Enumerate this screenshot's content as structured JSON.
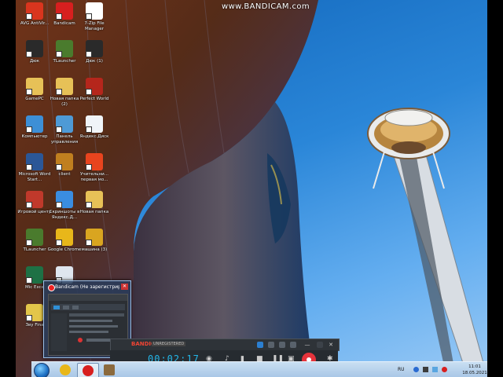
{
  "watermark": "www.BANDICAM.com",
  "desktop_icons": [
    {
      "label": "AVG AntiVir...",
      "icon": "avg-icon",
      "color": "#d9351e",
      "col": 0,
      "row": 0
    },
    {
      "label": "Bandicam",
      "icon": "bandicam-icon",
      "color": "#d71f1f",
      "col": 1,
      "row": 0
    },
    {
      "label": "7-Zip File Manager",
      "icon": "7zip-icon",
      "color": "#ffffff",
      "col": 2,
      "row": 0
    },
    {
      "label": "Дюк",
      "icon": "duck-app-icon",
      "color": "#2a2a2a",
      "col": 0,
      "row": 1
    },
    {
      "label": "TLauncher",
      "icon": "tlauncher-icon",
      "color": "#4a7b2d",
      "col": 1,
      "row": 1
    },
    {
      "label": "Дюк (1)",
      "icon": "duck-app-icon",
      "color": "#2a2a2a",
      "col": 2,
      "row": 1
    },
    {
      "label": "GamePC",
      "icon": "folder-icon",
      "color": "#e7c157",
      "col": 0,
      "row": 2
    },
    {
      "label": "Новая папка (2)",
      "icon": "folder-icon",
      "color": "#e7c157",
      "col": 1,
      "row": 2
    },
    {
      "label": "Perfect World",
      "icon": "perfect-world-icon",
      "color": "#b5261c",
      "col": 2,
      "row": 2
    },
    {
      "label": "Компьютер",
      "icon": "computer-icon",
      "color": "#3d8fd6",
      "col": 0,
      "row": 3
    },
    {
      "label": "Панель управления",
      "icon": "control-panel-icon",
      "color": "#4e9ad6",
      "col": 1,
      "row": 3
    },
    {
      "label": "Яндекс.Диск",
      "icon": "yandex-disk-icon",
      "color": "#f0f4f8",
      "col": 2,
      "row": 3
    },
    {
      "label": "Microsoft Word Start...",
      "icon": "word-icon",
      "color": "#2b5797",
      "col": 0,
      "row": 4
    },
    {
      "label": "client",
      "icon": "client-icon",
      "color": "#c07f1f",
      "col": 1,
      "row": 4
    },
    {
      "label": "Учительни... первая мо...",
      "icon": "media-icon",
      "color": "#e8441e",
      "col": 2,
      "row": 4
    },
    {
      "label": "Игровой центр",
      "icon": "game-center-icon",
      "color": "#c0392b",
      "col": 0,
      "row": 5
    },
    {
      "label": "Скриншоты в Яндекс.Д...",
      "icon": "screenshots-icon",
      "color": "#3a8de0",
      "col": 1,
      "row": 5
    },
    {
      "label": "Новая папка",
      "icon": "folder-icon",
      "color": "#e7c157",
      "col": 2,
      "row": 5
    },
    {
      "label": "TLauncher",
      "icon": "tlauncher-icon",
      "color": "#4a7b2d",
      "col": 0,
      "row": 6
    },
    {
      "label": "Google Chrome",
      "icon": "chrome-icon",
      "color": "#e8b71a",
      "col": 1,
      "row": 6
    },
    {
      "label": "машина (3)",
      "icon": "file-icon",
      "color": "#d9a520",
      "col": 2,
      "row": 6
    },
    {
      "label": "Mic Exce",
      "icon": "excel-icon",
      "color": "#1e7145",
      "col": 0,
      "row": 7
    },
    {
      "label": "",
      "icon": "paw-icon",
      "color": "#dfe6ee",
      "col": 1,
      "row": 7
    },
    {
      "label": "Зву Fina",
      "icon": "sound-icon",
      "color": "#e3c64a",
      "col": 0,
      "row": 8
    }
  ],
  "bandicam_bar": {
    "brand": "BANDICAM",
    "registered": "UNREGISTERED",
    "timer": "00:02:17",
    "minimize": "—",
    "close": "✕"
  },
  "thumbnail": {
    "title": "Bandicam (Не зарегистрир...",
    "close": "✕"
  },
  "tray": {
    "lang": "RU",
    "time": "11:01",
    "date": "18.05.2021"
  },
  "taskbar_buttons": [
    {
      "icon": "chrome-icon",
      "color": "#e8b71a"
    },
    {
      "icon": "bandicam-icon",
      "color": "#d71f1f"
    },
    {
      "icon": "minecraft-icon",
      "color": "#8b6a3e"
    }
  ]
}
